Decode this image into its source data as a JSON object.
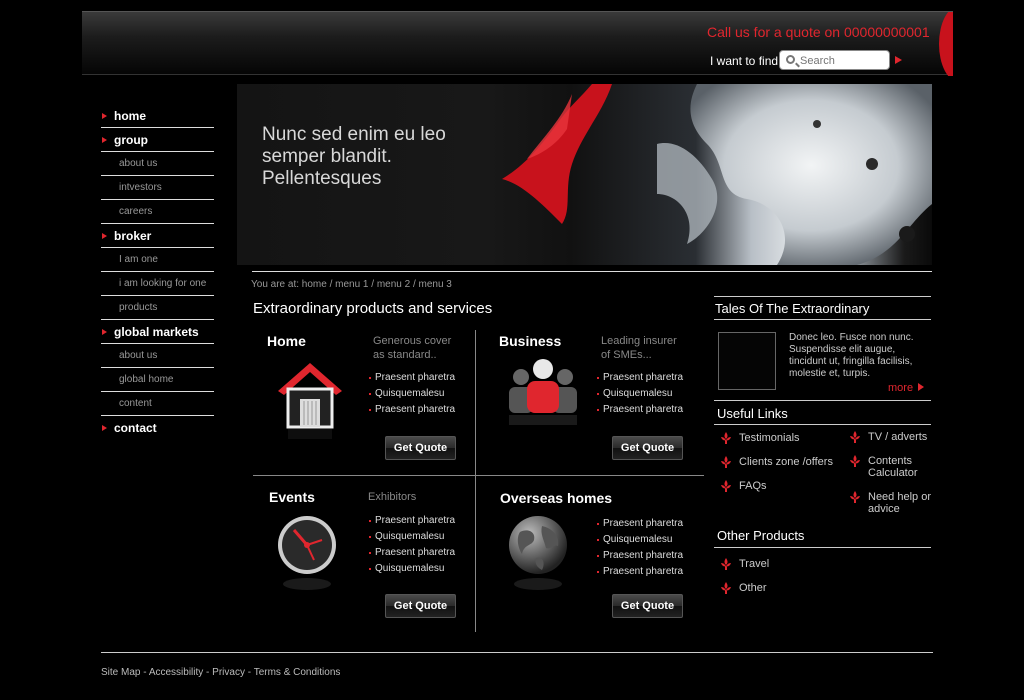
{
  "header": {
    "phone_text": "Call us for a quote on 00000000001",
    "find_label": "I want to find",
    "search_placeholder": "Search"
  },
  "sidebar": {
    "items": [
      {
        "label": "home",
        "type": "main"
      },
      {
        "label": "group",
        "type": "main"
      },
      {
        "label": "about us",
        "type": "sub"
      },
      {
        "label": "intvestors",
        "type": "sub"
      },
      {
        "label": "careers",
        "type": "sub"
      },
      {
        "label": "broker",
        "type": "main"
      },
      {
        "label": "I am one",
        "type": "sub"
      },
      {
        "label": "i am looking for one",
        "type": "sub"
      },
      {
        "label": "products",
        "type": "sub"
      },
      {
        "label": "global markets",
        "type": "main"
      },
      {
        "label": "about us",
        "type": "sub"
      },
      {
        "label": "global home",
        "type": "sub"
      },
      {
        "label": "content",
        "type": "sub"
      },
      {
        "label": "contact",
        "type": "main"
      }
    ]
  },
  "banner": {
    "line1": "Nunc sed enim eu leo",
    "line2": "semper blandit.",
    "line3": "Pellentesques"
  },
  "breadcrumb": "You are at: home / menu 1 / menu 2 / menu 3",
  "main": {
    "title": "Extraordinary products and services",
    "products": [
      {
        "title": "Home",
        "sub1": "Generous cover",
        "sub2": "as standard..",
        "bullets": [
          "Praesent pharetra",
          "Quisquemalesu",
          "Praesent pharetra"
        ],
        "button": "Get Quote"
      },
      {
        "title": "Business",
        "sub1": "Leading insurer",
        "sub2": "of SMEs...",
        "bullets": [
          "Praesent pharetra",
          "Quisquemalesu",
          "Praesent pharetra"
        ],
        "button": "Get Quote"
      },
      {
        "title": "Events",
        "sub1": "Exhibitors",
        "sub2": "",
        "bullets": [
          "Praesent pharetra",
          "Quisquemalesu",
          "Praesent pharetra",
          "Quisquemalesu"
        ],
        "button": "Get Quote"
      },
      {
        "title": "Overseas homes",
        "sub1": "",
        "sub2": "",
        "bullets": [
          "Praesent pharetra",
          "Quisquemalesu",
          "Praesent pharetra",
          "Praesent pharetra"
        ],
        "button": "Get Quote"
      }
    ]
  },
  "right": {
    "tales_title": "Tales Of The Extraordinary",
    "tales_text": "Donec leo. Fusce non nunc. Suspendisse elit augue, tincidunt ut, fringilla facilisis, molestie et, turpis.",
    "tales_more": "more",
    "useful_title": "Useful Links",
    "useful_left": [
      "Testimonials",
      "Clients zone /offers",
      "FAQs"
    ],
    "useful_right": [
      "TV / adverts",
      "Contents Calculator",
      "Need help or advice"
    ],
    "other_title": "Other Products",
    "other_items": [
      "Travel",
      "Other"
    ]
  },
  "footer": {
    "links": [
      "Site Map",
      "Accessibility",
      "Privacy",
      "Terms & Conditions"
    ],
    "separator": " - "
  },
  "colors": {
    "accent": "#e0262e",
    "background": "#000000",
    "text": "#ffffff",
    "muted": "#999999"
  }
}
